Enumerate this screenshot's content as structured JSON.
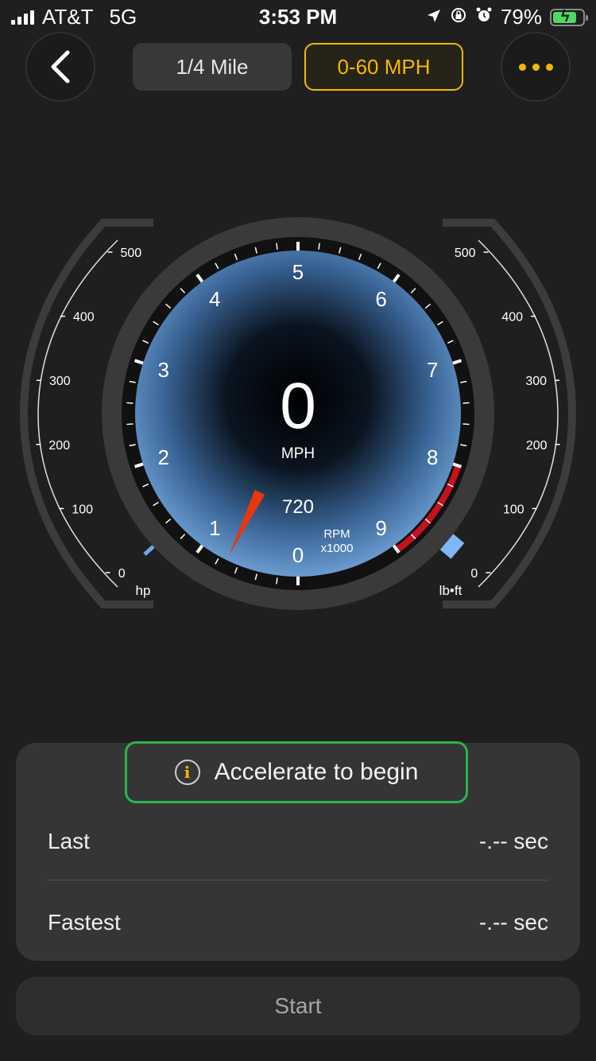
{
  "status_bar": {
    "carrier": "AT&T",
    "network": "5G",
    "time": "3:53 PM",
    "battery": "79%",
    "battery_level": 0.79
  },
  "nav": {
    "tabs": [
      "1/4 Mile",
      "0-60 MPH"
    ],
    "active_tab": "0-60 MPH"
  },
  "gauge": {
    "speed": "0",
    "speed_unit": "MPH",
    "rpm_value": "720",
    "rpm_label": "RPM",
    "rpm_scale": "x1000",
    "rpm_ticks": [
      "0",
      "1",
      "2",
      "3",
      "4",
      "5",
      "6",
      "7",
      "8",
      "9"
    ],
    "rpm_needle": 0.72,
    "hp_scale": [
      "0",
      "100",
      "200",
      "300",
      "400",
      "500"
    ],
    "hp_unit": "hp",
    "torque_scale": [
      "0",
      "100",
      "200",
      "300",
      "400",
      "500"
    ],
    "torque_unit": "lb•ft"
  },
  "panel": {
    "message": "Accelerate to begin",
    "rows": [
      {
        "label": "Last",
        "value": "-.-- sec"
      },
      {
        "label": "Fastest",
        "value": "-.-- sec"
      }
    ]
  },
  "start_label": "Start",
  "colors": {
    "accent": "#f5b800",
    "highlight": "#2db34a",
    "redline": "#c8101e",
    "needle": "#e8360e",
    "dial": "#5b8fc9"
  }
}
